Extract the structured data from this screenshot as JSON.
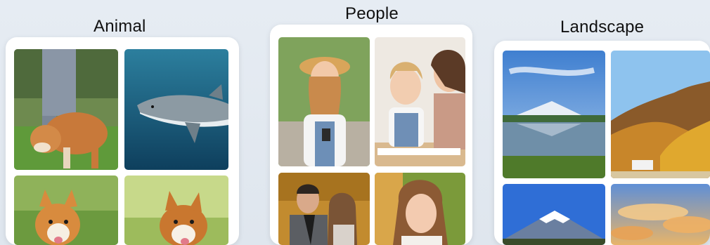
{
  "groups": {
    "animal": {
      "label": "Animal",
      "images": [
        {
          "subject": "shiba dog on grass on a leash"
        },
        {
          "subject": "great white shark underwater"
        },
        {
          "subject": "corgi dog on grass"
        },
        {
          "subject": "corgi dog in sunlit meadow"
        }
      ]
    },
    "people": {
      "label": "People",
      "images": [
        {
          "subject": "woman in straw hat holding phone"
        },
        {
          "subject": "mother and daughter drawing at table"
        },
        {
          "subject": "couple in autumn park"
        },
        {
          "subject": "smiling young woman outdoors"
        }
      ]
    },
    "landscape": {
      "label": "Landscape",
      "images": [
        {
          "subject": "snowy mountain reflected in lake"
        },
        {
          "subject": "autumn forested hillside"
        },
        {
          "subject": "mount fuji under blue sky"
        },
        {
          "subject": "golden sunset clouds"
        }
      ]
    }
  },
  "colors": {
    "background": "#e3e9f0",
    "card": "#ffffff",
    "label": "#111111"
  }
}
